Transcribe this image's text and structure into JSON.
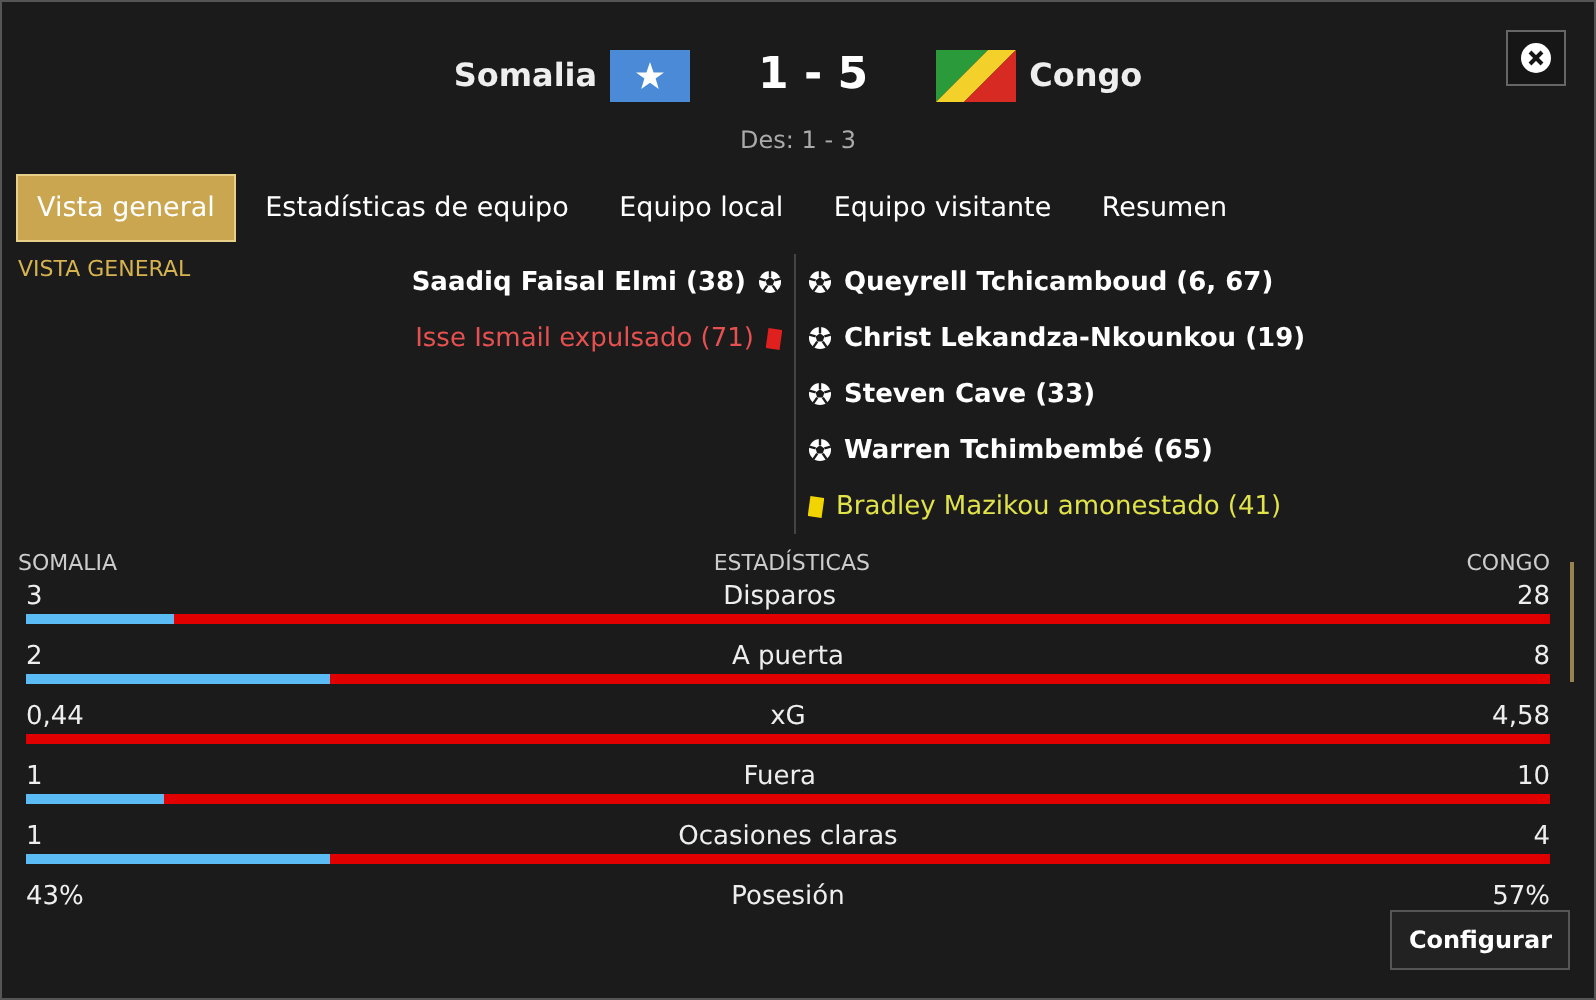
{
  "match": {
    "home": "Somalia",
    "away": "Congo",
    "score": "1 - 5",
    "tiebreak": "Des: 1 - 3"
  },
  "tabs": [
    {
      "label": "Vista general",
      "selected": true
    },
    {
      "label": "Estadísticas de equipo",
      "selected": false
    },
    {
      "label": "Equipo local",
      "selected": false
    },
    {
      "label": "Equipo visitante",
      "selected": false
    },
    {
      "label": "Resumen",
      "selected": false
    }
  ],
  "section_title": "VISTA GENERAL",
  "home_events": [
    {
      "kind": "goal",
      "text": "Saadiq Faisal Elmi (38)"
    },
    {
      "kind": "red",
      "text": "Isse Ismail expulsado (71)"
    }
  ],
  "away_events": [
    {
      "kind": "goal",
      "text": "Queyrell Tchicamboud (6, 67)"
    },
    {
      "kind": "goal",
      "text": "Christ Lekandza-Nkounkou (19)"
    },
    {
      "kind": "goal",
      "text": "Steven Cave (33)"
    },
    {
      "kind": "goal",
      "text": "Warren Tchimbembé (65)"
    },
    {
      "kind": "yellow",
      "text": "Bradley Mazikou amonestado (41)"
    }
  ],
  "stats_header": {
    "home": "SOMALIA",
    "title": "ESTADÍSTICAS",
    "away": "CONGO"
  },
  "stats": [
    {
      "label": "Disparos",
      "home": "3",
      "away": "28",
      "kind": "bar",
      "level": 0.097
    },
    {
      "label": "A puerta",
      "home": "2",
      "away": "8",
      "kind": "bar",
      "level": 0.2
    },
    {
      "label": "xG",
      "home": "0,44",
      "away": "4,58",
      "kind": "bar"
    },
    {
      "label": "Fuera",
      "home": "1",
      "away": "10",
      "kind": "bar",
      "level": 0.09
    },
    {
      "label": "Ocasiones claras",
      "home": "1",
      "away": "4",
      "kind": "bar",
      "level": 0.2
    },
    {
      "label": "Posesión",
      "home": "43%",
      "away": "57%",
      "kind": "plain"
    }
  ],
  "configure_button": "Configurar"
}
